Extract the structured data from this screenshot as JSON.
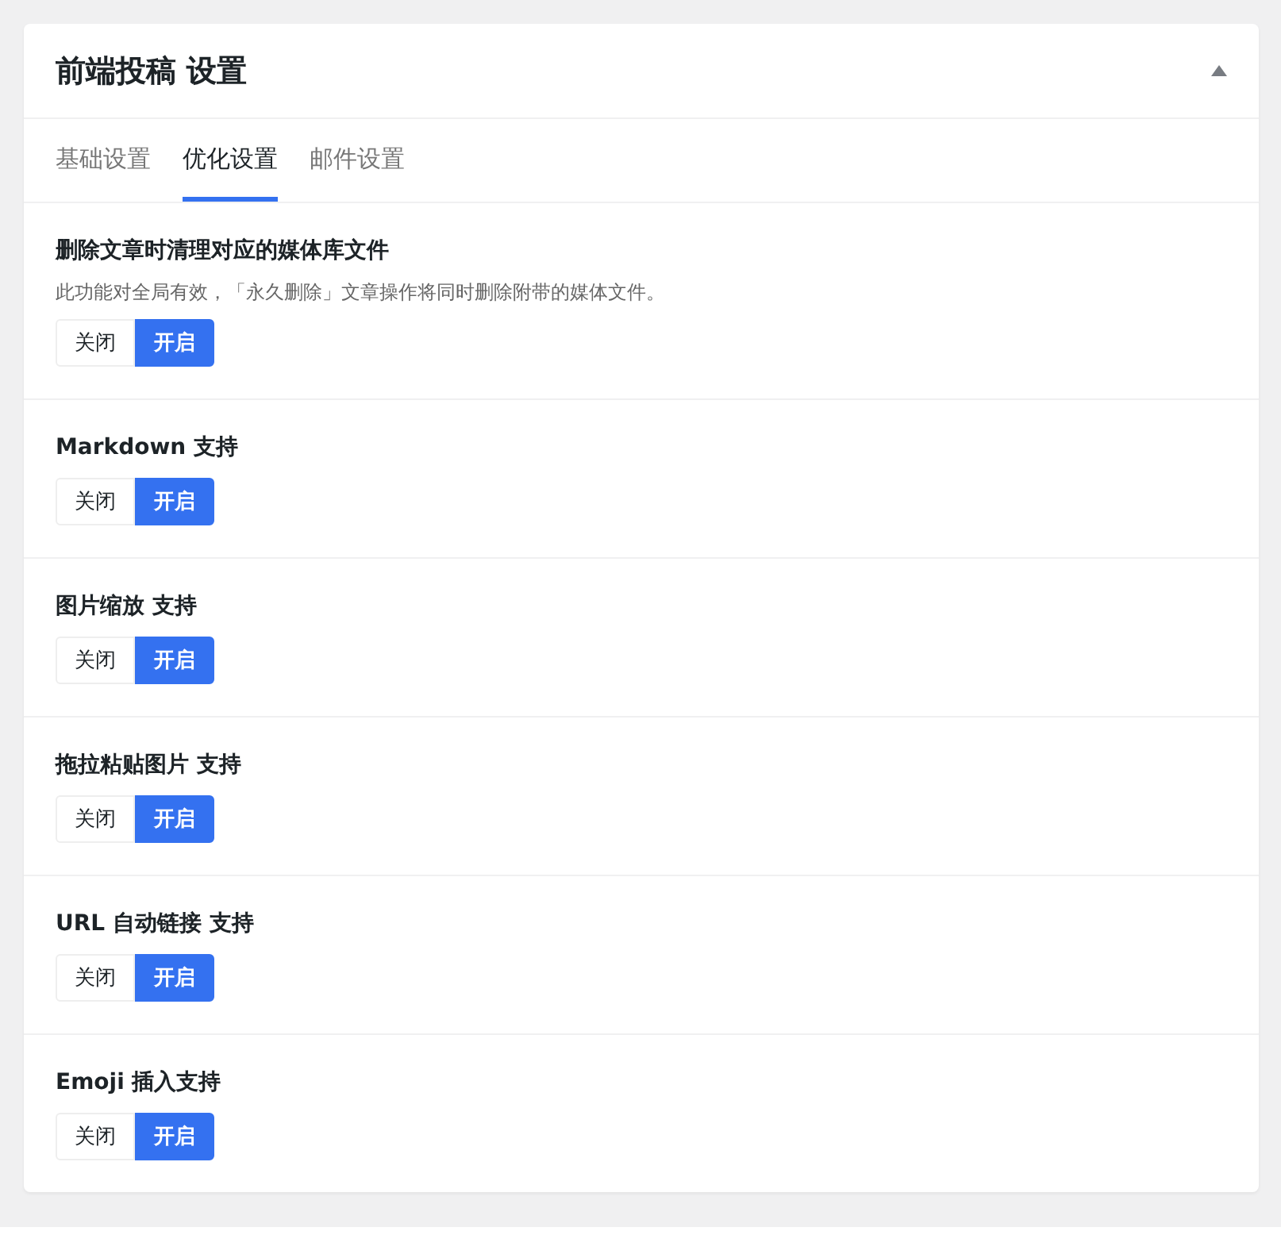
{
  "panel": {
    "title": "前端投稿 设置"
  },
  "tabs": [
    {
      "label": "基础设置",
      "selected": false
    },
    {
      "label": "优化设置",
      "selected": true
    },
    {
      "label": "邮件设置",
      "selected": false
    }
  ],
  "settings": [
    {
      "title": "删除文章时清理对应的媒体库文件",
      "description": "此功能对全局有效，「永久删除」文章操作将同时删除附带的媒体文件。",
      "options": [
        {
          "label": "关闭",
          "selected": false
        },
        {
          "label": "开启",
          "selected": true
        }
      ]
    },
    {
      "title": "Markdown 支持",
      "options": [
        {
          "label": "关闭",
          "selected": false
        },
        {
          "label": "开启",
          "selected": true
        }
      ]
    },
    {
      "title": "图片缩放 支持",
      "options": [
        {
          "label": "关闭",
          "selected": false
        },
        {
          "label": "开启",
          "selected": true
        }
      ]
    },
    {
      "title": "拖拉粘贴图片 支持",
      "options": [
        {
          "label": "关闭",
          "selected": false
        },
        {
          "label": "开启",
          "selected": true
        }
      ]
    },
    {
      "title": "URL 自动链接 支持",
      "options": [
        {
          "label": "关闭",
          "selected": false
        },
        {
          "label": "开启",
          "selected": true
        }
      ]
    },
    {
      "title": "Emoji 插入支持",
      "options": [
        {
          "label": "关闭",
          "selected": false
        },
        {
          "label": "开启",
          "selected": true
        }
      ]
    }
  ]
}
